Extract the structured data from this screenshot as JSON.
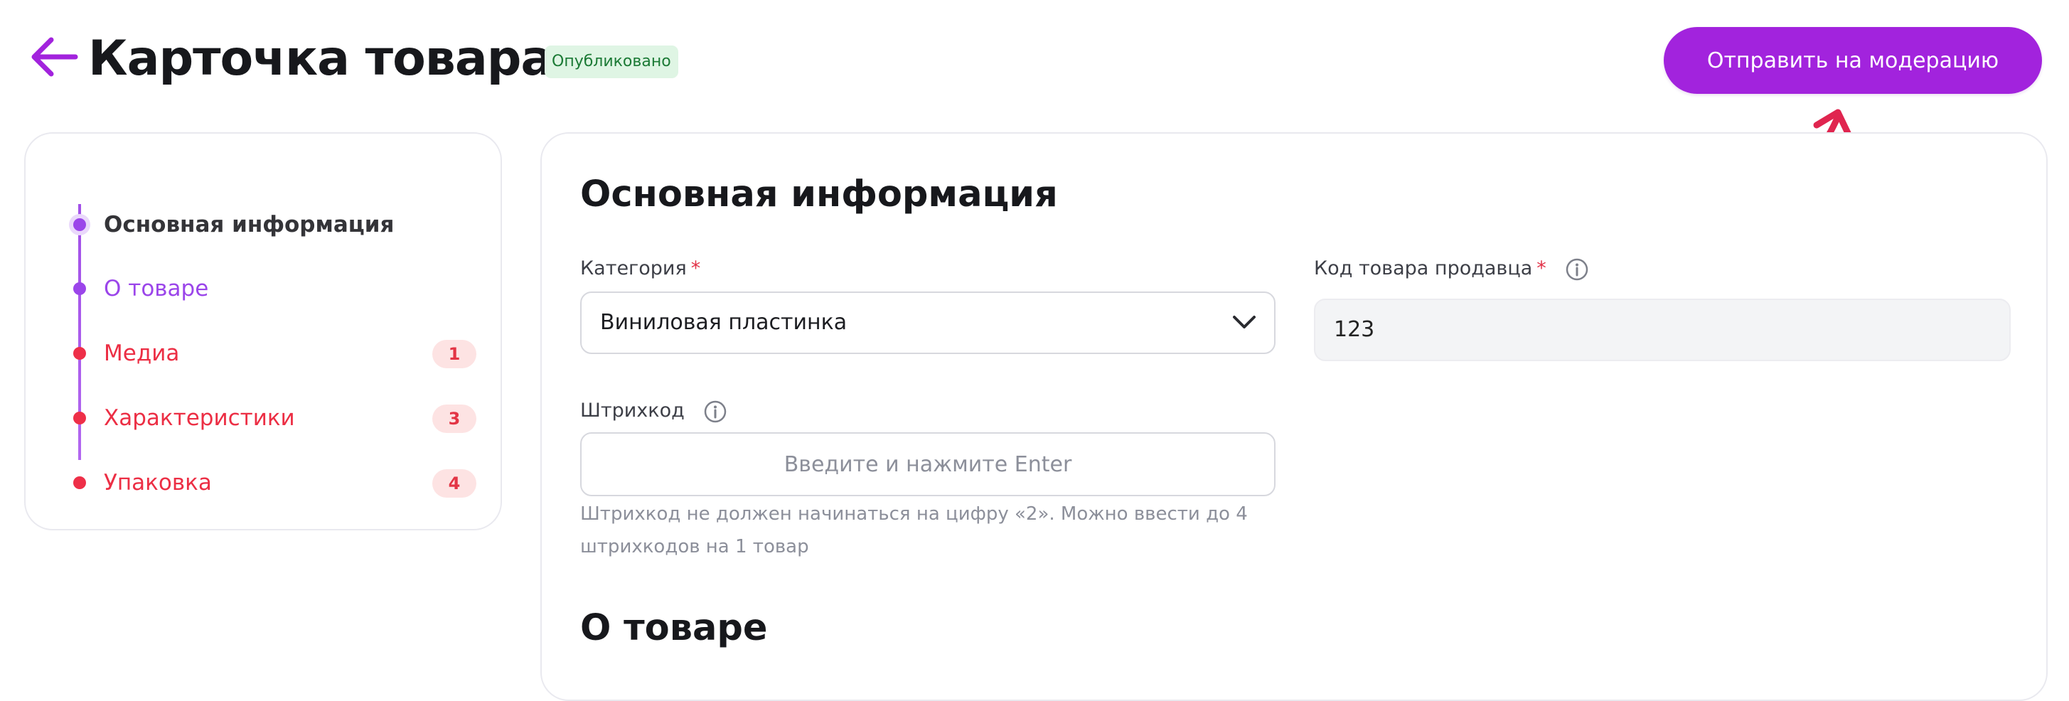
{
  "header": {
    "title": "Карточка товара",
    "status_badge": "Опубликовано",
    "moderate_button": "Отправить на модерацию"
  },
  "sidebar": {
    "steps": [
      {
        "label": "Основная информация",
        "state": "active"
      },
      {
        "label": "О товаре",
        "state": "done"
      },
      {
        "label": "Медиа",
        "state": "error",
        "count": "1"
      },
      {
        "label": "Характеристики",
        "state": "error",
        "count": "3"
      },
      {
        "label": "Упаковка",
        "state": "error",
        "count": "4"
      }
    ]
  },
  "main": {
    "section_title": "Основная информация",
    "category": {
      "label": "Категория",
      "required": "*",
      "value": "Виниловая пластинка"
    },
    "seller_code": {
      "label": "Код товара продавца",
      "required": "*",
      "value": "123"
    },
    "barcode": {
      "label": "Штрихкод",
      "placeholder": "Введите и нажмите Enter",
      "helper_line1": "Штрихкод не должен начинаться на цифру «2». Можно ввести до 4",
      "helper_line2": "штрихкодов на 1 товар"
    },
    "next_section_title": "О товаре"
  },
  "colors": {
    "accent": "#a223dd",
    "step_active": "#9b45ea",
    "step_error": "#ec2e44",
    "badge_bg": "#dff5e4",
    "badge_text": "#1b7a35",
    "hint_arrow": "#e0254f"
  },
  "icons": [
    "arrow-left-icon",
    "chevron-down-icon",
    "info-icon",
    "curved-arrow-icon"
  ]
}
